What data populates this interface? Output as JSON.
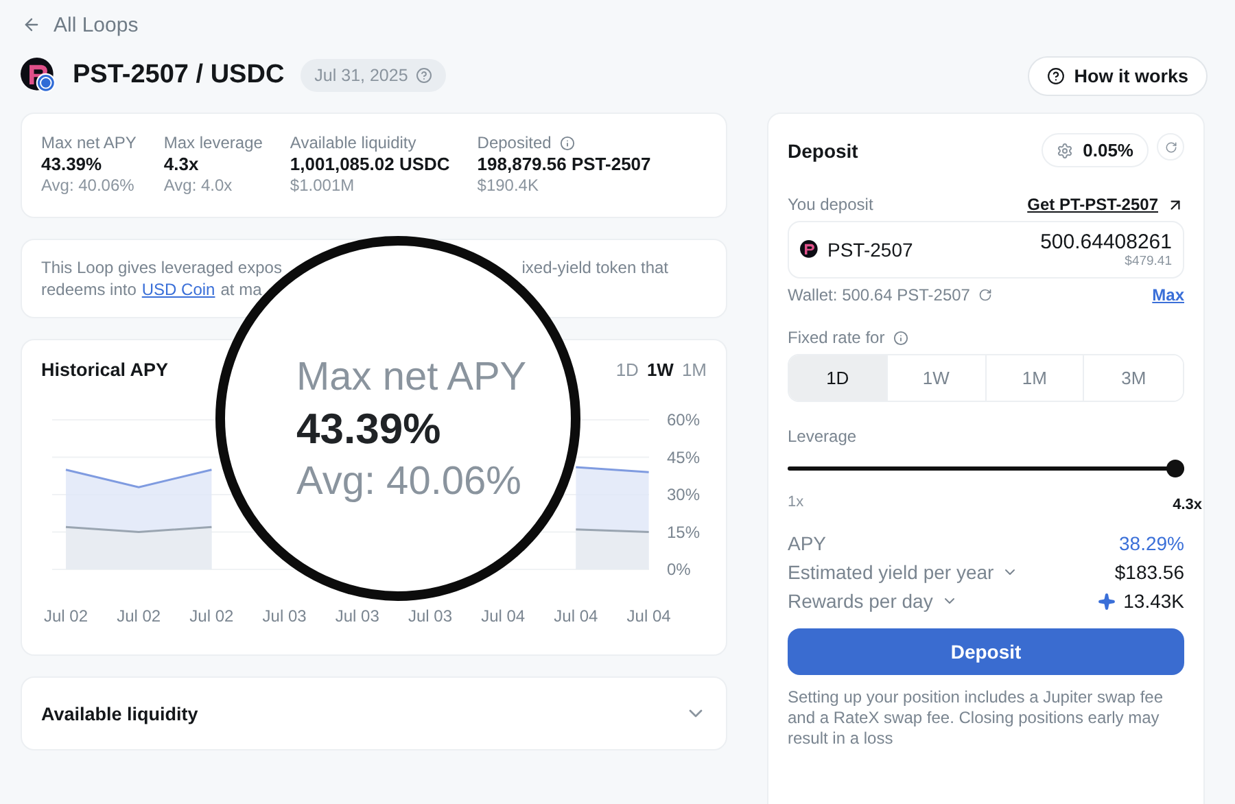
{
  "back_link": "All Loops",
  "header": {
    "title": "PST-2507 / USDC",
    "date": "Jul 31, 2025",
    "help_button": "How it works"
  },
  "stats": [
    {
      "label": "Max net APY",
      "value": "43.39%",
      "sub": "Avg: 40.06%",
      "info": false
    },
    {
      "label": "Max leverage",
      "value": "4.3x",
      "sub": "Avg: 4.0x",
      "info": false
    },
    {
      "label": "Available liquidity",
      "value": "1,001,085.02 USDC",
      "sub": "$1.001M",
      "info": false
    },
    {
      "label": "Deposited",
      "value": "198,879.56 PST-2507",
      "sub": "$190.4K",
      "info": true
    }
  ],
  "description": {
    "line_1_start": "This Loop gives leveraged expos",
    "line_1_end": "ixed-yield token that",
    "line_2_start": "redeems into",
    "line_2_link": "USD Coin",
    "line_2_end": "at ma"
  },
  "chart": {
    "title": "Historical APY",
    "ranges": [
      {
        "label": "1D",
        "selected": false
      },
      {
        "label": "1W",
        "selected": true
      },
      {
        "label": "1M",
        "selected": false
      }
    ],
    "chart_data": {
      "type": "area",
      "categories": [
        "Jul 02",
        "Jul 02",
        "Jul 02",
        "Jul 03",
        "Jul 03",
        "Jul 03",
        "Jul 04",
        "Jul 04",
        "Jul 04"
      ],
      "series": [
        {
          "color": "#7f9be0",
          "values": [
            40,
            33,
            40,
            null,
            null,
            null,
            null,
            41,
            39
          ]
        },
        {
          "color": "#9aa5b1",
          "values": [
            17,
            15,
            17,
            null,
            null,
            null,
            null,
            16,
            15
          ]
        }
      ],
      "ylim": [
        0,
        60
      ],
      "grid": true,
      "yticks": [
        {
          "value": 60,
          "label": "60%"
        },
        {
          "value": 45,
          "label": "45%"
        },
        {
          "value": 30,
          "label": "30%"
        },
        {
          "value": 15,
          "label": "15%"
        },
        {
          "value": 0,
          "label": "0%"
        }
      ]
    }
  },
  "liquidity_section": {
    "title": "Available liquidity",
    "expanded": false
  },
  "magnifier": {
    "label": "Max net APY",
    "value": "43.39%",
    "sub": "Avg: 40.06%"
  },
  "deposit": {
    "title": "Deposit",
    "slippage": "0.05%",
    "you_deposit": "You deposit",
    "get_link": "Get PT-PST-2507",
    "token": "PST-2507",
    "amount": "500.64408261",
    "amount_usd": "$479.41",
    "wallet": "Wallet: 500.64 PST-2507",
    "max": "Max",
    "fixed_rate_label": "Fixed rate for",
    "rates": [
      {
        "label": "1D",
        "selected": true
      },
      {
        "label": "1W",
        "selected": false
      },
      {
        "label": "1M",
        "selected": false
      },
      {
        "label": "3M",
        "selected": false
      }
    ],
    "leverage_label": "Leverage",
    "leverage": {
      "level": 1,
      "min": "1x",
      "value": "4.3x"
    },
    "rows": [
      {
        "label": "APY",
        "value": "38.29%",
        "kind": "plain"
      },
      {
        "label": "Estimated yield per year",
        "value": "$183.56",
        "kind": "dropdown"
      },
      {
        "label": "Rewards per day",
        "value": "13.43K",
        "kind": "reward"
      }
    ],
    "button": "Deposit",
    "note": "Setting up your position includes a Jupiter swap fee and a RateX swap fee. Closing positions early may result in a loss"
  }
}
